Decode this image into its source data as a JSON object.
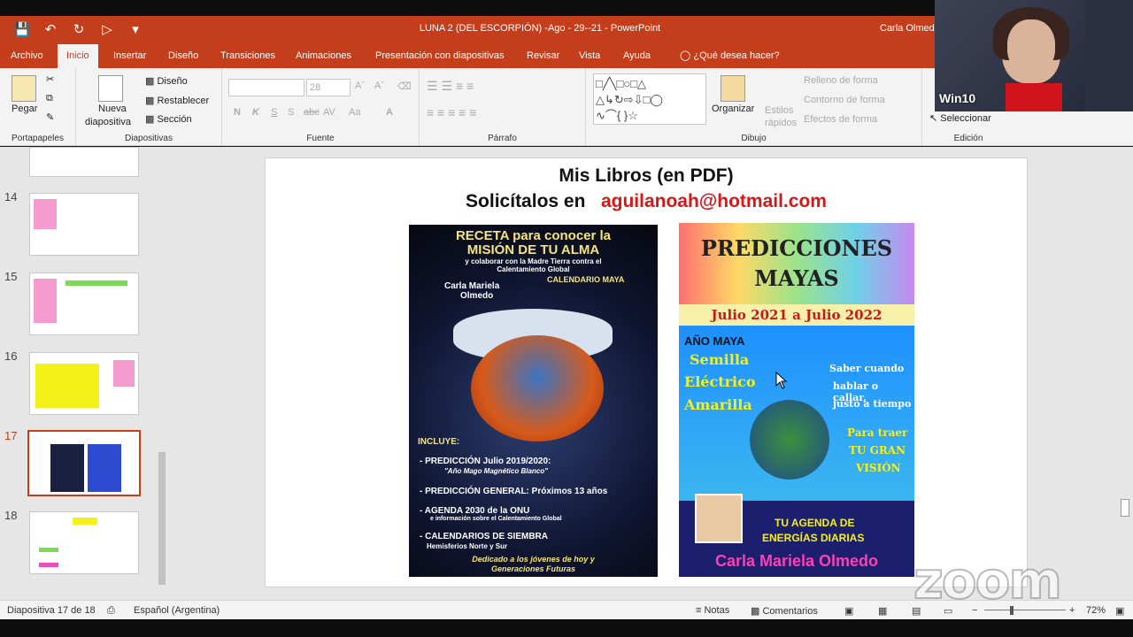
{
  "window": {
    "title": "LUNA 2 (DEL ESCORPIÓN) -Ago - 29--21  -  PowerPoint",
    "user": "Carla Olmed"
  },
  "tabs": [
    "Archivo",
    "Inicio",
    "Insertar",
    "Diseño",
    "Transiciones",
    "Animaciones",
    "Presentación con diapositivas",
    "Revisar",
    "Vista",
    "Ayuda",
    "¿Qué desea hacer?"
  ],
  "ribbon": {
    "portapapeles": {
      "paste": "Pegar",
      "label": "Portapapeles"
    },
    "diapositivas": {
      "new_slide_1": "Nueva",
      "new_slide_2": "diapositiva",
      "layout": "Diseño",
      "reset": "Restablecer",
      "section": "Sección",
      "label": "Diapositivas"
    },
    "fuente": {
      "size": "28",
      "label": "Fuente",
      "bold": "N",
      "italic": "K",
      "underline": "S",
      "shadow": "S",
      "strike": "abc",
      "spacing": "AV",
      "case": "Aa"
    },
    "parrafo": {
      "label": "Párrafo"
    },
    "dibujo": {
      "arrange": "Organizar",
      "styles_1": "Estilos",
      "styles_2": "rápidos",
      "fill": "Relleno de forma",
      "outline": "Contorno de forma",
      "effects": "Efectos de forma",
      "label": "Dibujo"
    },
    "edicion": {
      "select": "Seleccionar",
      "label": "Edición"
    }
  },
  "thumbnails": [
    {
      "num": "14"
    },
    {
      "num": "15"
    },
    {
      "num": "16"
    },
    {
      "num": "17",
      "selected": true
    },
    {
      "num": "18"
    }
  ],
  "slide": {
    "title": "Mis Libros (en PDF)",
    "subtitle_prefix": "Solicítalos en",
    "email": "aguilanoah@hotmail.com",
    "book1": {
      "heading1": "RECETA para conocer la",
      "heading2": "MISIÓN DE TU ALMA",
      "sub1": "y colaborar con la Madre Tierra contra el",
      "sub2": "Calentamiento Global",
      "author1": "Carla Mariela",
      "author2": "Olmedo",
      "calendar": "CALENDARIO MAYA",
      "incluye": "INCLUYE:",
      "item1": "- PREDICCIÓN Julio 2019/2020:",
      "item1b": "\"Año Mago Magnético Blanco\"",
      "item2": "- PREDICCIÓN GENERAL: Próximos 13 años",
      "item3": "- AGENDA 2030 de la ONU",
      "item3b": "e información sobre el Calentamiento Global",
      "item4": "- CALENDARIOS DE SIEMBRA",
      "item4b": "Hemisferios Norte y Sur",
      "footer1": "Dedicado a los jóvenes de hoy y",
      "footer2": "Generaciones Futuras"
    },
    "book2": {
      "title1": "PREDICCIONES",
      "title2": "MAYAS",
      "dates": "Julio 2021 a Julio 2022",
      "year": "AÑO MAYA",
      "seed1": "Semilla",
      "seed2": "Eléctrico",
      "seed3": "Amarilla",
      "quote1": "Saber cuando",
      "quote2": "hablar o callar,",
      "quote3": "justo a tiempo",
      "vision1": "Para traer",
      "vision2": "TU GRAN",
      "vision3": "VISIÓN",
      "agenda1": "TU AGENDA DE",
      "agenda2": "ENERGÍAS DIARIAS",
      "author": "Carla Mariela Olmedo"
    }
  },
  "status": {
    "slide_count": "Diapositiva 17 de 18",
    "language": "Español (Argentina)",
    "notes": "Notas",
    "comments": "Comentarios",
    "zoom": "72%"
  },
  "webcam": {
    "label": "Win10"
  },
  "watermark": "zoom",
  "colors": {
    "accent": "#c43e1c",
    "email": "#d41818"
  }
}
